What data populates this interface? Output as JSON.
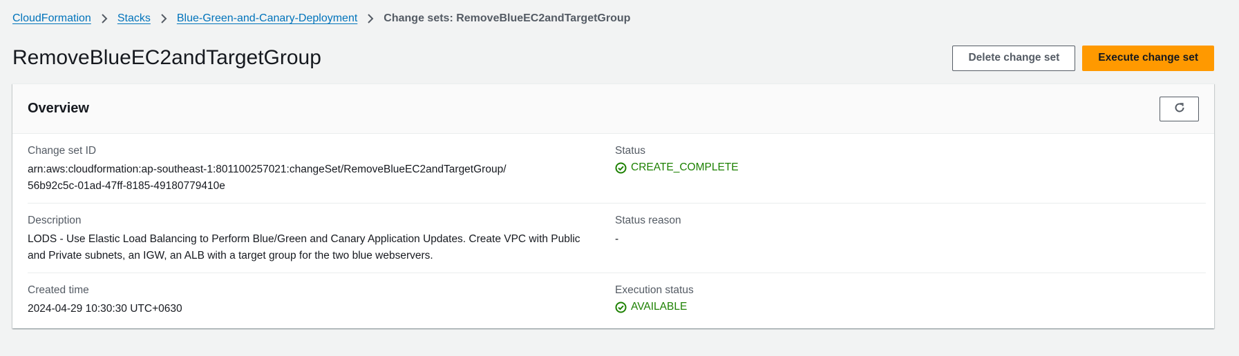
{
  "breadcrumb": {
    "items": [
      "CloudFormation",
      "Stacks",
      "Blue-Green-and-Canary-Deployment"
    ],
    "current": "Change sets: RemoveBlueEC2andTargetGroup"
  },
  "header": {
    "title": "RemoveBlueEC2andTargetGroup",
    "delete_label": "Delete change set",
    "execute_label": "Execute change set"
  },
  "overview": {
    "title": "Overview",
    "refresh_icon": "refresh-icon",
    "change_set_id": {
      "label": "Change set ID",
      "value_line1": "arn:aws:cloudformation:ap-southeast-1:801100257021:changeSet/RemoveBlueEC2andTargetGroup/",
      "value_line2": "56b92c5c-01ad-47ff-8185-49180779410e"
    },
    "status": {
      "label": "Status",
      "value": "CREATE_COMPLETE"
    },
    "description": {
      "label": "Description",
      "value_line1": "LODS - Use Elastic Load Balancing to Perform Blue/Green and Canary Application Updates. Create VPC with Public",
      "value_line2": "and Private subnets, an IGW, an ALB with a target group for the two blue webservers."
    },
    "status_reason": {
      "label": "Status reason",
      "value": "-"
    },
    "created_time": {
      "label": "Created time",
      "value": "2024-04-29 10:30:30 UTC+0630"
    },
    "execution_status": {
      "label": "Execution status",
      "value": "AVAILABLE"
    }
  },
  "colors": {
    "link": "#0073bb",
    "primary_button": "#ff9900",
    "success": "#1d8102",
    "background": "#f2f3f3"
  }
}
